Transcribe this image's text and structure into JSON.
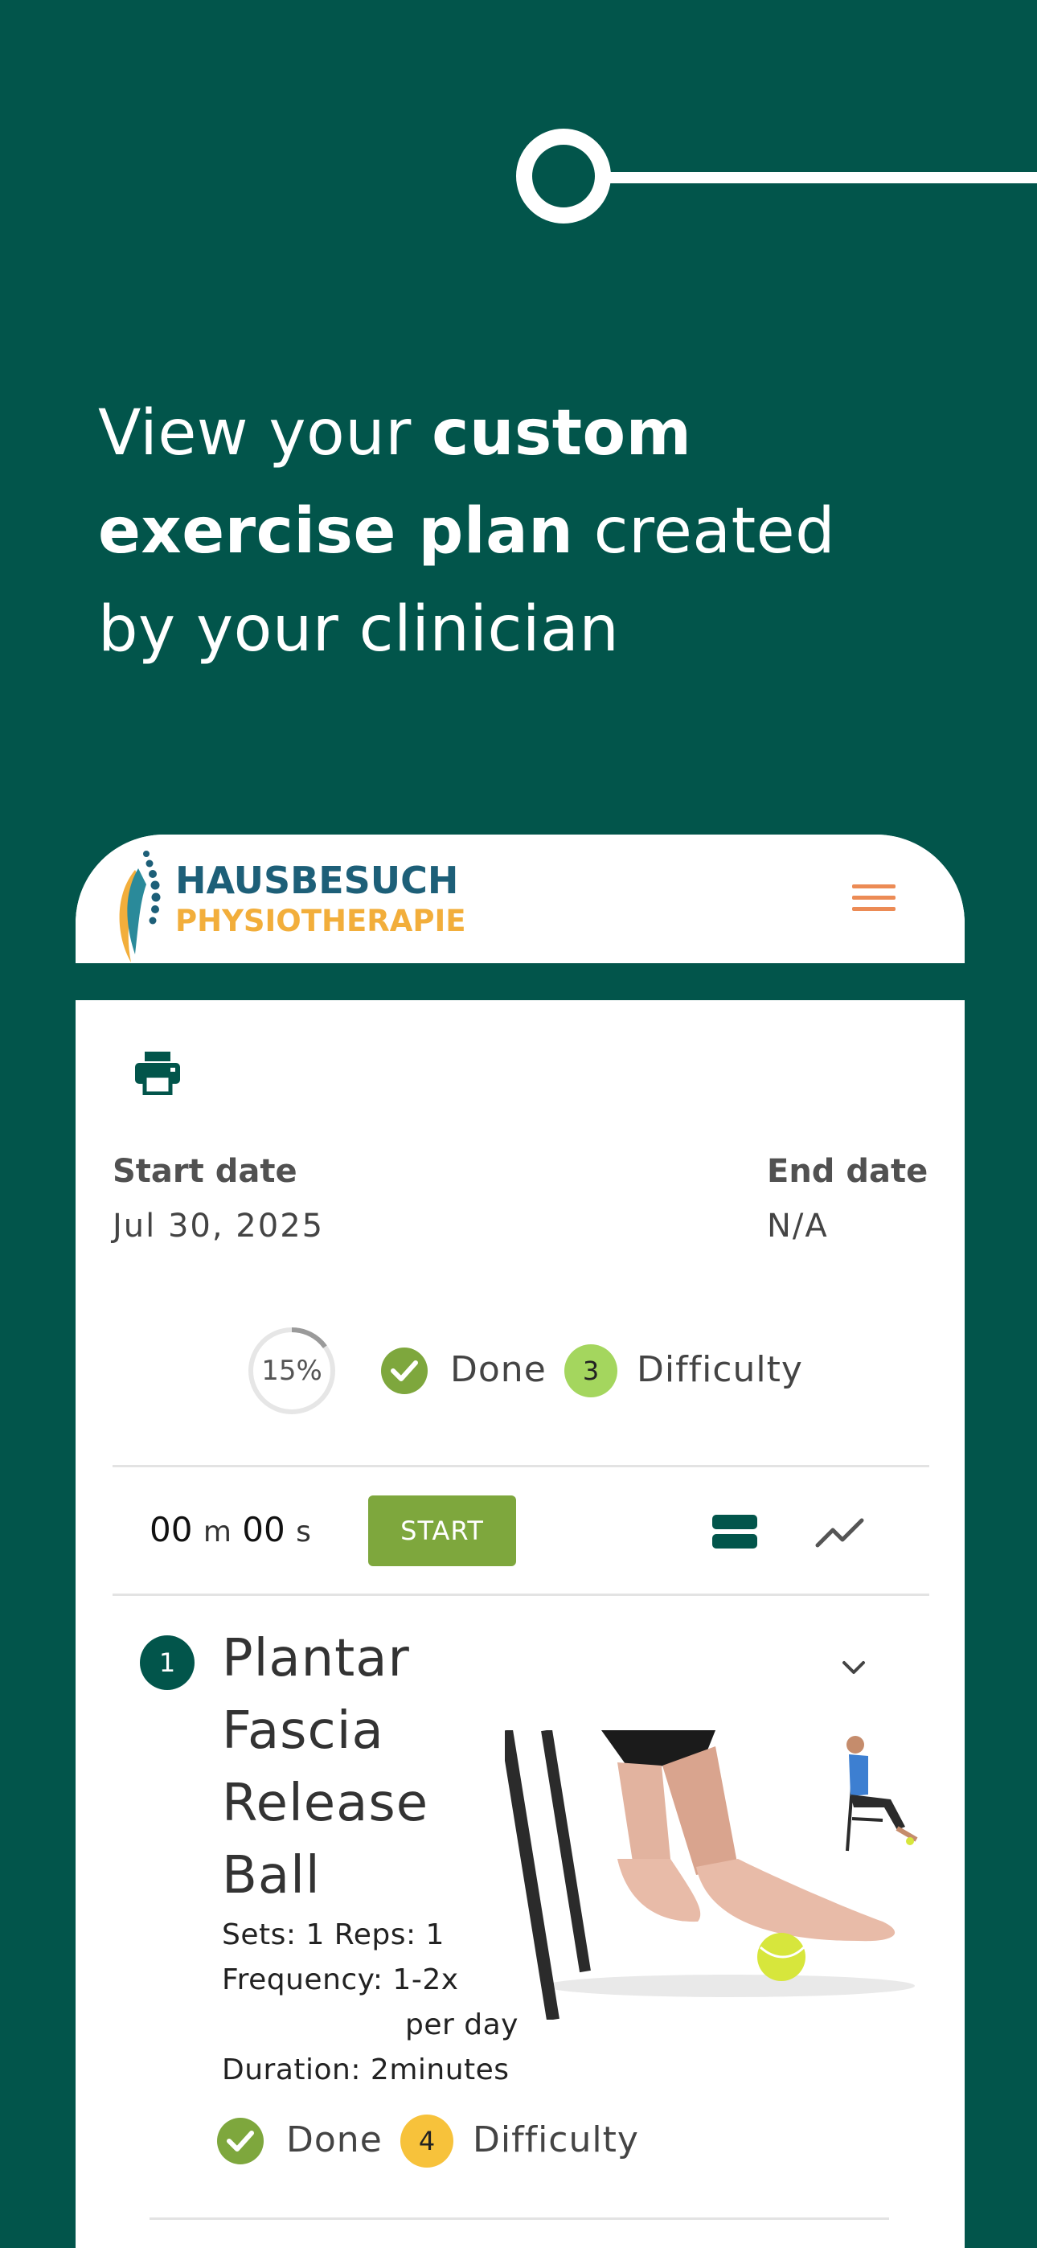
{
  "headline": {
    "part1": "View your ",
    "part2_bold": "custom exercise plan",
    "part3": " created by your clinician"
  },
  "brand": {
    "line1": "HAUSBESUCH",
    "line2": "PHYSIOTHERAPIE",
    "colors": {
      "primary": "#02554b",
      "logo_blue": "#1d5f78",
      "logo_orange": "#f2ae3b",
      "menu": "#ec8b55",
      "accent_green": "#7ea73d"
    }
  },
  "plan": {
    "start_label": "Start date",
    "start_value": "Jul 30, 2025",
    "end_label": "End date",
    "end_value": "N/A",
    "progress_percent": 15,
    "progress_text": "15%",
    "done_label": "Done",
    "difficulty_value": "3",
    "difficulty_label": "Difficulty"
  },
  "timer": {
    "minutes": "00",
    "minutes_unit": "m",
    "seconds": "00",
    "seconds_unit": "s",
    "start_label": "START"
  },
  "exercises": [
    {
      "number": "1",
      "title": "Plantar Fascia Release Ball",
      "sets_reps": "Sets: 1 Reps: 1",
      "frequency_a": "Frequency: 1-2x",
      "frequency_b": "per day",
      "duration": "Duration: 2minutes",
      "done_label": "Done",
      "difficulty_value": "4",
      "difficulty_label": "Difficulty"
    }
  ],
  "icons": [
    "print-icon",
    "menu-icon",
    "check-icon",
    "list-view-icon",
    "chart-icon",
    "chevron-down-icon"
  ]
}
